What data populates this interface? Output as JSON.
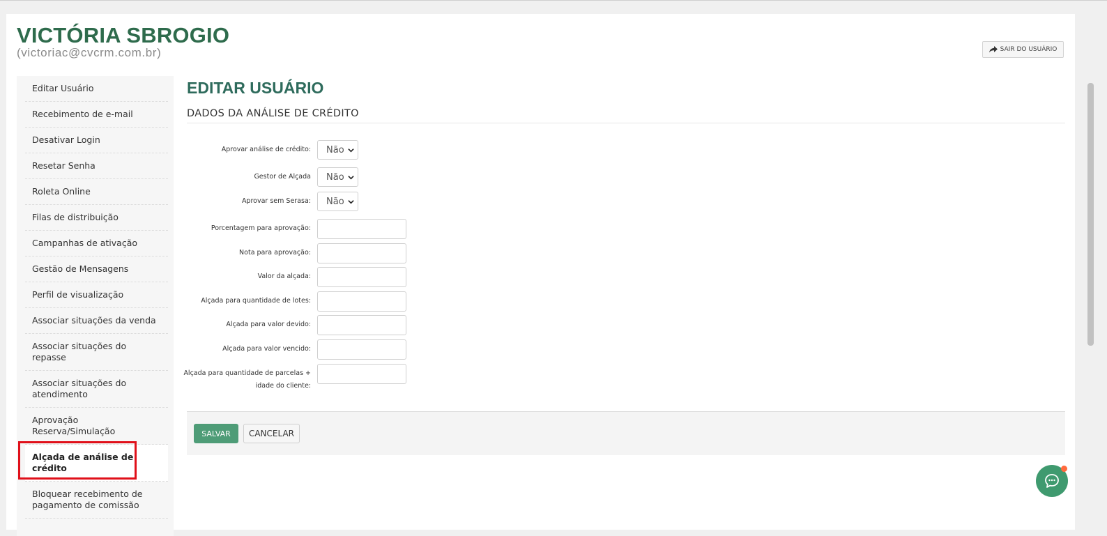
{
  "user": {
    "name": "VICTÓRIA SBROGIO",
    "email": "(victoriac@cvcrm.com.br)",
    "logout_label": "SAIR DO USUÁRIO"
  },
  "sidebar": {
    "items": [
      {
        "label": "Editar Usuário"
      },
      {
        "label": "Recebimento de e-mail"
      },
      {
        "label": "Desativar Login"
      },
      {
        "label": "Resetar Senha"
      },
      {
        "label": "Roleta Online"
      },
      {
        "label": "Filas de distribuição"
      },
      {
        "label": "Campanhas de ativação"
      },
      {
        "label": "Gestão de Mensagens"
      },
      {
        "label": "Perfil de visualização"
      },
      {
        "label": "Associar situações da venda"
      },
      {
        "label": "Associar situações do repasse"
      },
      {
        "label": "Associar situações do atendimento"
      },
      {
        "label": "Aprovação Reserva/Simulação"
      },
      {
        "label": "Alçada de análise de crédito"
      },
      {
        "label": "Bloquear recebimento de pagamento de comissão"
      }
    ],
    "active": "Alçada de análise de crédito"
  },
  "main": {
    "title": "EDITAR USUÁRIO",
    "section": "DADOS DA ANÁLISE DE CRÉDITO",
    "fields": {
      "aprovar_analise": {
        "label": "Aprovar análise de crédito:",
        "value": "Não"
      },
      "gestor_alcada": {
        "label": "Gestor de Alçada",
        "value": "Não"
      },
      "aprovar_sem_serasa": {
        "label": "Aprovar sem Serasa:",
        "value": "Não"
      },
      "porcentagem": {
        "label": "Porcentagem para aprovação:",
        "value": ""
      },
      "nota": {
        "label": "Nota para aprovação:",
        "value": ""
      },
      "valor_alcada": {
        "label": "Valor da alçada:",
        "value": ""
      },
      "qtd_lotes": {
        "label": "Alçada para quantidade de lotes:",
        "value": ""
      },
      "valor_devido": {
        "label": "Alçada para valor devido:",
        "value": ""
      },
      "valor_vencido": {
        "label": "Alçada para valor vencido:",
        "value": ""
      },
      "qtd_parcelas": {
        "label": "Alçada para quantidade de parcelas + idade do cliente:",
        "value": ""
      }
    },
    "save_label": "SALVAR",
    "cancel_label": "CANCELAR"
  },
  "colors": {
    "brand_green": "#2e6b4c",
    "button_green": "#4e9c77",
    "highlight_red": "#e0101a",
    "notification_orange": "#ff6a3d"
  }
}
